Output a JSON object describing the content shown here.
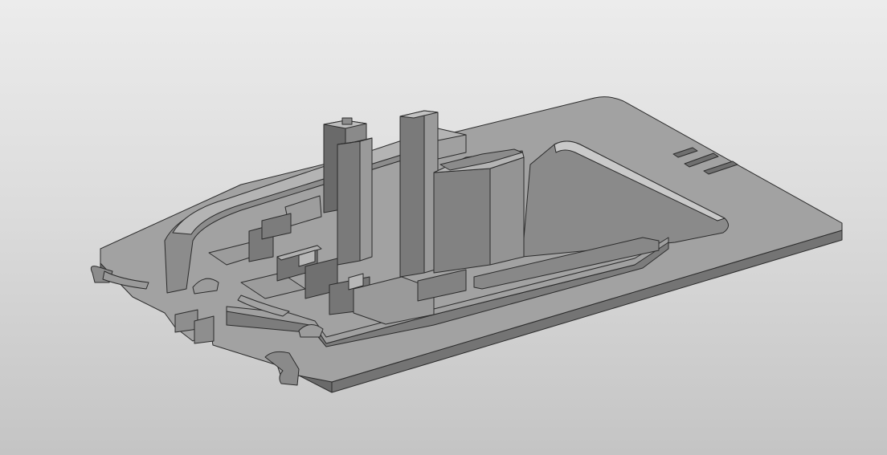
{
  "viewport": {
    "background_top": "#ececec",
    "background_bottom": "#c4c4c4"
  },
  "model": {
    "shade_top": "#9a9a9a",
    "shade_side": "#6f6f6f",
    "shade_dark": "#5b5b5b",
    "edge_color": "#2b2b2b"
  }
}
